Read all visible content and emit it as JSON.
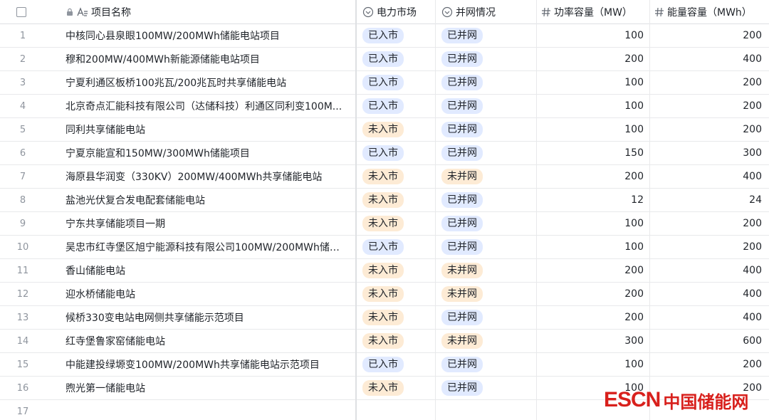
{
  "columns": {
    "name": "项目名称",
    "market": "电力市场",
    "grid": "并网情况",
    "power": "功率容量（MW）",
    "energy": "能量容量（MWh）"
  },
  "colors": {
    "tag_in_market_bg": "#e1eaff",
    "tag_not_market_bg": "#fdebd5",
    "tag_connected_bg": "#e1eaff",
    "tag_not_connected_bg": "#fdebd5",
    "watermark": "#d8201c"
  },
  "rows": [
    {
      "num": "1",
      "name": "中核同心县泉眼100MW/200MWh储能电站项目",
      "market": "已入市",
      "grid": "已并网",
      "power": "100",
      "energy": "200"
    },
    {
      "num": "2",
      "name": "穆和200MW/400MWh新能源储能电站项目",
      "market": "已入市",
      "grid": "已并网",
      "power": "200",
      "energy": "400"
    },
    {
      "num": "3",
      "name": "宁夏利通区板桥100兆瓦/200兆瓦时共享储能电站",
      "market": "已入市",
      "grid": "已并网",
      "power": "100",
      "energy": "200"
    },
    {
      "num": "4",
      "name": "北京奇点汇能科技有限公司（达储科技）利通区同利变100M...",
      "market": "已入市",
      "grid": "已并网",
      "power": "100",
      "energy": "200"
    },
    {
      "num": "5",
      "name": "同利共享储能电站",
      "market": "未入市",
      "grid": "已并网",
      "power": "100",
      "energy": "200"
    },
    {
      "num": "6",
      "name": "宁夏京能宣和150MW/300MWh储能项目",
      "market": "已入市",
      "grid": "已并网",
      "power": "150",
      "energy": "300"
    },
    {
      "num": "7",
      "name": "海原县华润变（330KV）200MW/400MWh共享储能电站",
      "market": "未入市",
      "grid": "未并网",
      "power": "200",
      "energy": "400"
    },
    {
      "num": "8",
      "name": "盐池光伏复合发电配套储能电站",
      "market": "未入市",
      "grid": "已并网",
      "power": "12",
      "energy": "24"
    },
    {
      "num": "9",
      "name": "宁东共享储能项目一期",
      "market": "未入市",
      "grid": "已并网",
      "power": "100",
      "energy": "200"
    },
    {
      "num": "10",
      "name": "吴忠市红寺堡区旭宁能源科技有限公司100MW/200MWh储能...",
      "market": "已入市",
      "grid": "已并网",
      "power": "100",
      "energy": "200"
    },
    {
      "num": "11",
      "name": "香山储能电站",
      "market": "未入市",
      "grid": "未并网",
      "power": "200",
      "energy": "400"
    },
    {
      "num": "12",
      "name": "迎水桥储能电站",
      "market": "未入市",
      "grid": "未并网",
      "power": "200",
      "energy": "400"
    },
    {
      "num": "13",
      "name": "候桥330变电站电网侧共享储能示范项目",
      "market": "未入市",
      "grid": "已并网",
      "power": "200",
      "energy": "400"
    },
    {
      "num": "14",
      "name": "红寺堡鲁家窑储能电站",
      "market": "未入市",
      "grid": "未并网",
      "power": "300",
      "energy": "600"
    },
    {
      "num": "15",
      "name": "中能建投绿塬变100MW/200MWh共享储能电站示范项目",
      "market": "已入市",
      "grid": "已并网",
      "power": "100",
      "energy": "200"
    },
    {
      "num": "16",
      "name": "煦光第一储能电站",
      "market": "未入市",
      "grid": "已并网",
      "power": "100",
      "energy": "200"
    },
    {
      "num": "17",
      "name": "",
      "market": "",
      "grid": "",
      "power": "",
      "energy": ""
    }
  ],
  "watermark": {
    "latin": "ESCN",
    "cn": "中国储能网"
  }
}
